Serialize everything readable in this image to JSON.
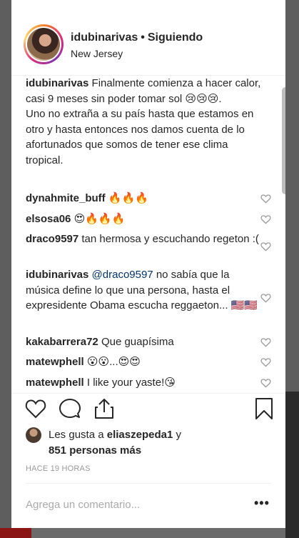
{
  "post": {
    "username": "idubinarivas",
    "separator": "•",
    "follow_status": "Siguiendo",
    "location": "New Jersey"
  },
  "comments": [
    {
      "handle": "idubinarivas",
      "text": "Finalmente comienza a hacer calor, casi 9 meses sin poder tomar sol 😢😢😢.",
      "text2": "Uno no extraña a su país hasta que estamos en otro y hasta entonces nos damos cuenta de lo afortunados que somos de tener ese clima tropical."
    },
    {
      "handle": "dynahmite_buff",
      "text": "🔥🔥🔥"
    },
    {
      "handle": "elsosa06",
      "text": "😍🔥🔥🔥"
    },
    {
      "handle": "draco9597",
      "text": "tan hermosa y escuchando regeton :("
    },
    {
      "handle": "idubinarivas",
      "mention": "@draco9597",
      "text": "no sabía que la música define lo que una persona, hasta el expresidente Obama escucha reggaeton... 🇺🇸🇺🇸"
    },
    {
      "handle": "kakabarrera72",
      "text": "Que guapísima"
    },
    {
      "handle": "matewphell",
      "text": "😮😮...😍😍"
    },
    {
      "handle": "matewphell",
      "text": "I like your yaste!😘"
    }
  ],
  "actions": {
    "like_icon": "heart-outline-icon",
    "comment_icon": "speech-bubble-icon",
    "share_icon": "share-upload-icon",
    "save_icon": "bookmark-icon"
  },
  "likes": {
    "prefix": "Les gusta a",
    "user": "eliaszepeda1",
    "conjunction": "y",
    "others": "851 personas más"
  },
  "timestamp": "HACE 19 HORAS",
  "comment_box": {
    "placeholder": "Agrega un comentario...",
    "more_label": "•••"
  }
}
